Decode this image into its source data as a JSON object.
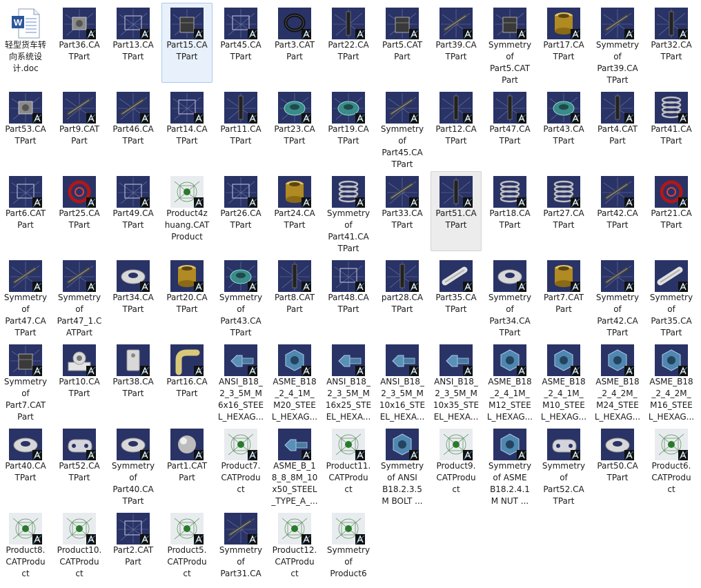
{
  "window": {
    "title": ""
  },
  "colors": {
    "icon_bg": "#2a3366",
    "icon_bg_dark": "#1b2147",
    "catia_badge_bg": "#111111",
    "catia_badge_fg": "#ffffff",
    "word_blue": "#2b579a",
    "selection_bg": "#ececec",
    "focus_bg": "#e8f1fb"
  },
  "files": [
    {
      "label": "轻型货车转\n向系统设\n计.doc",
      "icon": "word-doc-icon",
      "thumb": "doc"
    },
    {
      "label": "Part36.CA\nTPart",
      "icon": "catpart-icon",
      "thumb": "mech"
    },
    {
      "label": "Part13.CA\nTPart",
      "icon": "catpart-icon",
      "thumb": "wire"
    },
    {
      "label": "Part15.CA\nTPart",
      "icon": "catpart-icon",
      "thumb": "box",
      "state": "focused"
    },
    {
      "label": "Part45.CA\nTPart",
      "icon": "catpart-icon",
      "thumb": "wire"
    },
    {
      "label": "Part3.CAT\nPart",
      "icon": "catpart-icon",
      "thumb": "ring"
    },
    {
      "label": "Part22.CA\nTPart",
      "icon": "catpart-icon",
      "thumb": "rod"
    },
    {
      "label": "Part5.CAT\nPart",
      "icon": "catpart-icon",
      "thumb": "box"
    },
    {
      "label": "Part39.CA\nTPart",
      "icon": "catpart-icon",
      "thumb": "shaft"
    },
    {
      "label": "Symmetry\nof\nPart5.CAT\nPart",
      "icon": "catpart-icon",
      "thumb": "box"
    },
    {
      "label": "Part17.CA\nTPart",
      "icon": "catpart-icon",
      "thumb": "gold"
    },
    {
      "label": "Symmetry\nof\nPart39.CA\nTPart",
      "icon": "catpart-icon",
      "thumb": "shaft"
    },
    {
      "label": "Part32.CA\nTPart",
      "icon": "catpart-icon",
      "thumb": "rod"
    },
    {
      "label": "Part53.CA\nTPart",
      "icon": "catpart-icon",
      "thumb": "mech"
    },
    {
      "label": "Part9.CAT\nPart",
      "icon": "catpart-icon",
      "thumb": "shaft"
    },
    {
      "label": "Part46.CA\nTPart",
      "icon": "catpart-icon",
      "thumb": "shaft"
    },
    {
      "label": "Part14.CA\nTPart",
      "icon": "catpart-icon",
      "thumb": "wire"
    },
    {
      "label": "Part11.CA\nTPart",
      "icon": "catpart-icon",
      "thumb": "rod"
    },
    {
      "label": "Part23.CA\nTPart",
      "icon": "catpart-icon",
      "thumb": "teal"
    },
    {
      "label": "Part19.CA\nTPart",
      "icon": "catpart-icon",
      "thumb": "teal"
    },
    {
      "label": "Symmetry\nof\nPart45.CA\nTPart",
      "icon": "catpart-icon",
      "thumb": "shaft"
    },
    {
      "label": "Part12.CA\nTPart",
      "icon": "catpart-icon",
      "thumb": "rod"
    },
    {
      "label": "Part47.CA\nTPart",
      "icon": "catpart-icon",
      "thumb": "rod"
    },
    {
      "label": "Part43.CA\nTPart",
      "icon": "catpart-icon",
      "thumb": "teal"
    },
    {
      "label": "Part4.CAT\nPart",
      "icon": "catpart-icon",
      "thumb": "rod"
    },
    {
      "label": "Part41.CA\nTPart",
      "icon": "catpart-icon",
      "thumb": "coil"
    },
    {
      "label": "Part6.CAT\nPart",
      "icon": "catpart-icon",
      "thumb": "wire"
    },
    {
      "label": "Part25.CA\nTPart",
      "icon": "catpart-icon",
      "thumb": "red"
    },
    {
      "label": "Part49.CA\nTPart",
      "icon": "catpart-icon",
      "thumb": "wire"
    },
    {
      "label": "Product4z\nhuang.CAT\nProduct",
      "icon": "catproduct-icon",
      "thumb": "product"
    },
    {
      "label": "Part26.CA\nTPart",
      "icon": "catpart-icon",
      "thumb": "wire"
    },
    {
      "label": "Part24.CA\nTPart",
      "icon": "catpart-icon",
      "thumb": "gold"
    },
    {
      "label": "Symmetry\nof\nPart41.CA\nTPart",
      "icon": "catpart-icon",
      "thumb": "coil"
    },
    {
      "label": "Part33.CA\nTPart",
      "icon": "catpart-icon",
      "thumb": "shaft"
    },
    {
      "label": "Part51.CA\nTPart",
      "icon": "catpart-icon",
      "thumb": "rod",
      "state": "selected"
    },
    {
      "label": "Part18.CA\nTPart",
      "icon": "catpart-icon",
      "thumb": "coil"
    },
    {
      "label": "Part27.CA\nTPart",
      "icon": "catpart-icon",
      "thumb": "coil"
    },
    {
      "label": "Part42.CA\nTPart",
      "icon": "catpart-icon",
      "thumb": "shaft"
    },
    {
      "label": "Part21.CA\nTPart",
      "icon": "catpart-icon",
      "thumb": "red"
    },
    {
      "label": "Symmetry\nof\nPart47.CA\nTPart",
      "icon": "catpart-icon",
      "thumb": "shaft"
    },
    {
      "label": "Symmetry\nof\nPart47_1.C\nATPart",
      "icon": "catpart-icon",
      "thumb": "shaft"
    },
    {
      "label": "Part34.CA\nTPart",
      "icon": "catpart-icon",
      "thumb": "washer"
    },
    {
      "label": "Part20.CA\nTPart",
      "icon": "catpart-icon",
      "thumb": "gold"
    },
    {
      "label": "Symmetry\nof\nPart43.CA\nTPart",
      "icon": "catpart-icon",
      "thumb": "teal"
    },
    {
      "label": "Part8.CAT\nPart",
      "icon": "catpart-icon",
      "thumb": "rod"
    },
    {
      "label": "Part48.CA\nTPart",
      "icon": "catpart-icon",
      "thumb": "wire"
    },
    {
      "label": "part28.CA\nTPart",
      "icon": "catpart-icon",
      "thumb": "rod"
    },
    {
      "label": "Part35.CA\nTPart",
      "icon": "catpart-icon",
      "thumb": "pin"
    },
    {
      "label": "Symmetry\nof\nPart34.CA\nTPart",
      "icon": "catpart-icon",
      "thumb": "washer"
    },
    {
      "label": "Part7.CAT\nPart",
      "icon": "catpart-icon",
      "thumb": "gold"
    },
    {
      "label": "Symmetry\nof\nPart42.CA\nTPart",
      "icon": "catpart-icon",
      "thumb": "shaft"
    },
    {
      "label": "Symmetry\nof\nPart35.CA\nTPart",
      "icon": "catpart-icon",
      "thumb": "pin"
    },
    {
      "label": "Symmetry\nof\nPart7.CAT\nPart",
      "icon": "catpart-icon",
      "thumb": "box"
    },
    {
      "label": "Part10.CA\nTPart",
      "icon": "catpart-icon",
      "thumb": "bracket"
    },
    {
      "label": "Part38.CA\nTPart",
      "icon": "catpart-icon",
      "thumb": "block"
    },
    {
      "label": "Part16.CA\nTPart",
      "icon": "catpart-icon",
      "thumb": "pipe"
    },
    {
      "label": "ANSI_B18_\n2_3_5M_M\n6x16_STEE\nL_HEXAG...",
      "icon": "catpart-icon",
      "thumb": "bolt"
    },
    {
      "label": "ASME_B18\n_2_4_1M_\nM20_STEE\nL_HEXAG...",
      "icon": "catpart-icon",
      "thumb": "nut"
    },
    {
      "label": "ANSI_B18_\n2_3_5M_M\n16x25_STE\nEL_HEXA...",
      "icon": "catpart-icon",
      "thumb": "bolt"
    },
    {
      "label": "ANSI_B18_\n2_3_5M_M\n10x16_STE\nEL_HEXA...",
      "icon": "catpart-icon",
      "thumb": "bolt"
    },
    {
      "label": "ANSI_B18_\n2_3_5M_M\n10x35_STE\nEL_HEXA...",
      "icon": "catpart-icon",
      "thumb": "bolt"
    },
    {
      "label": "ASME_B18\n_2_4_1M_\nM12_STEE\nL_HEXAG...",
      "icon": "catpart-icon",
      "thumb": "nut"
    },
    {
      "label": "ASME_B18\n_2_4_1M_\nM10_STEE\nL_HEXAG...",
      "icon": "catpart-icon",
      "thumb": "nut"
    },
    {
      "label": "ASME_B18\n_2_4_2M_\nM24_STEE\nL_HEXAG...",
      "icon": "catpart-icon",
      "thumb": "nut"
    },
    {
      "label": "ASME_B18\n_2_4_2M_\nM16_STEE\nL_HEXAG...",
      "icon": "catpart-icon",
      "thumb": "nut"
    },
    {
      "label": "Part40.CA\nTPart",
      "icon": "catpart-icon",
      "thumb": "washer"
    },
    {
      "label": "Part52.CA\nTPart",
      "icon": "catpart-icon",
      "thumb": "plate"
    },
    {
      "label": "Symmetry\nof\nPart40.CA\nTPart",
      "icon": "catpart-icon",
      "thumb": "washer"
    },
    {
      "label": "Part1.CAT\nPart",
      "icon": "catpart-icon",
      "thumb": "sphere"
    },
    {
      "label": "Product7.\nCATProdu\nct",
      "icon": "catproduct-icon",
      "thumb": "product"
    },
    {
      "label": "ASME_B_1\n8_8_8M_10\nx50_STEEL\n_TYPE_A_...",
      "icon": "catpart-icon",
      "thumb": "bolt"
    },
    {
      "label": "Product11.\nCATProdu\nct",
      "icon": "catproduct-icon",
      "thumb": "product"
    },
    {
      "label": "Symmetry\nof ANSI\nB18.2.3.5\nM BOLT ...",
      "icon": "catpart-icon",
      "thumb": "nut"
    },
    {
      "label": "Product9.\nCATProdu\nct",
      "icon": "catproduct-icon",
      "thumb": "product"
    },
    {
      "label": "Symmetry\nof ASME\nB18.2.4.1\nM NUT ...",
      "icon": "catpart-icon",
      "thumb": "nut"
    },
    {
      "label": "Symmetry\nof\nPart52.CA\nTPart",
      "icon": "catpart-icon",
      "thumb": "plate"
    },
    {
      "label": "Part50.CA\nTPart",
      "icon": "catpart-icon",
      "thumb": "washer"
    },
    {
      "label": "Product6.\nCATProdu\nct",
      "icon": "catproduct-icon",
      "thumb": "product"
    },
    {
      "label": "Product8.\nCATProdu\nct",
      "icon": "catproduct-icon",
      "thumb": "product"
    },
    {
      "label": "Product10.\nCATProdu\nct",
      "icon": "catproduct-icon",
      "thumb": "product"
    },
    {
      "label": "Part2.CAT\nPart",
      "icon": "catpart-icon",
      "thumb": "wire"
    },
    {
      "label": "Product5.\nCATProdu\nct",
      "icon": "catproduct-icon",
      "thumb": "product"
    },
    {
      "label": "Symmetry\nof\nPart31.CA",
      "icon": "catpart-icon",
      "thumb": "shaft"
    },
    {
      "label": "Product12.\nCATProdu\nct",
      "icon": "catproduct-icon",
      "thumb": "product"
    },
    {
      "label": "Symmetry\nof\nProduct6",
      "icon": "catproduct-icon",
      "thumb": "product"
    }
  ]
}
